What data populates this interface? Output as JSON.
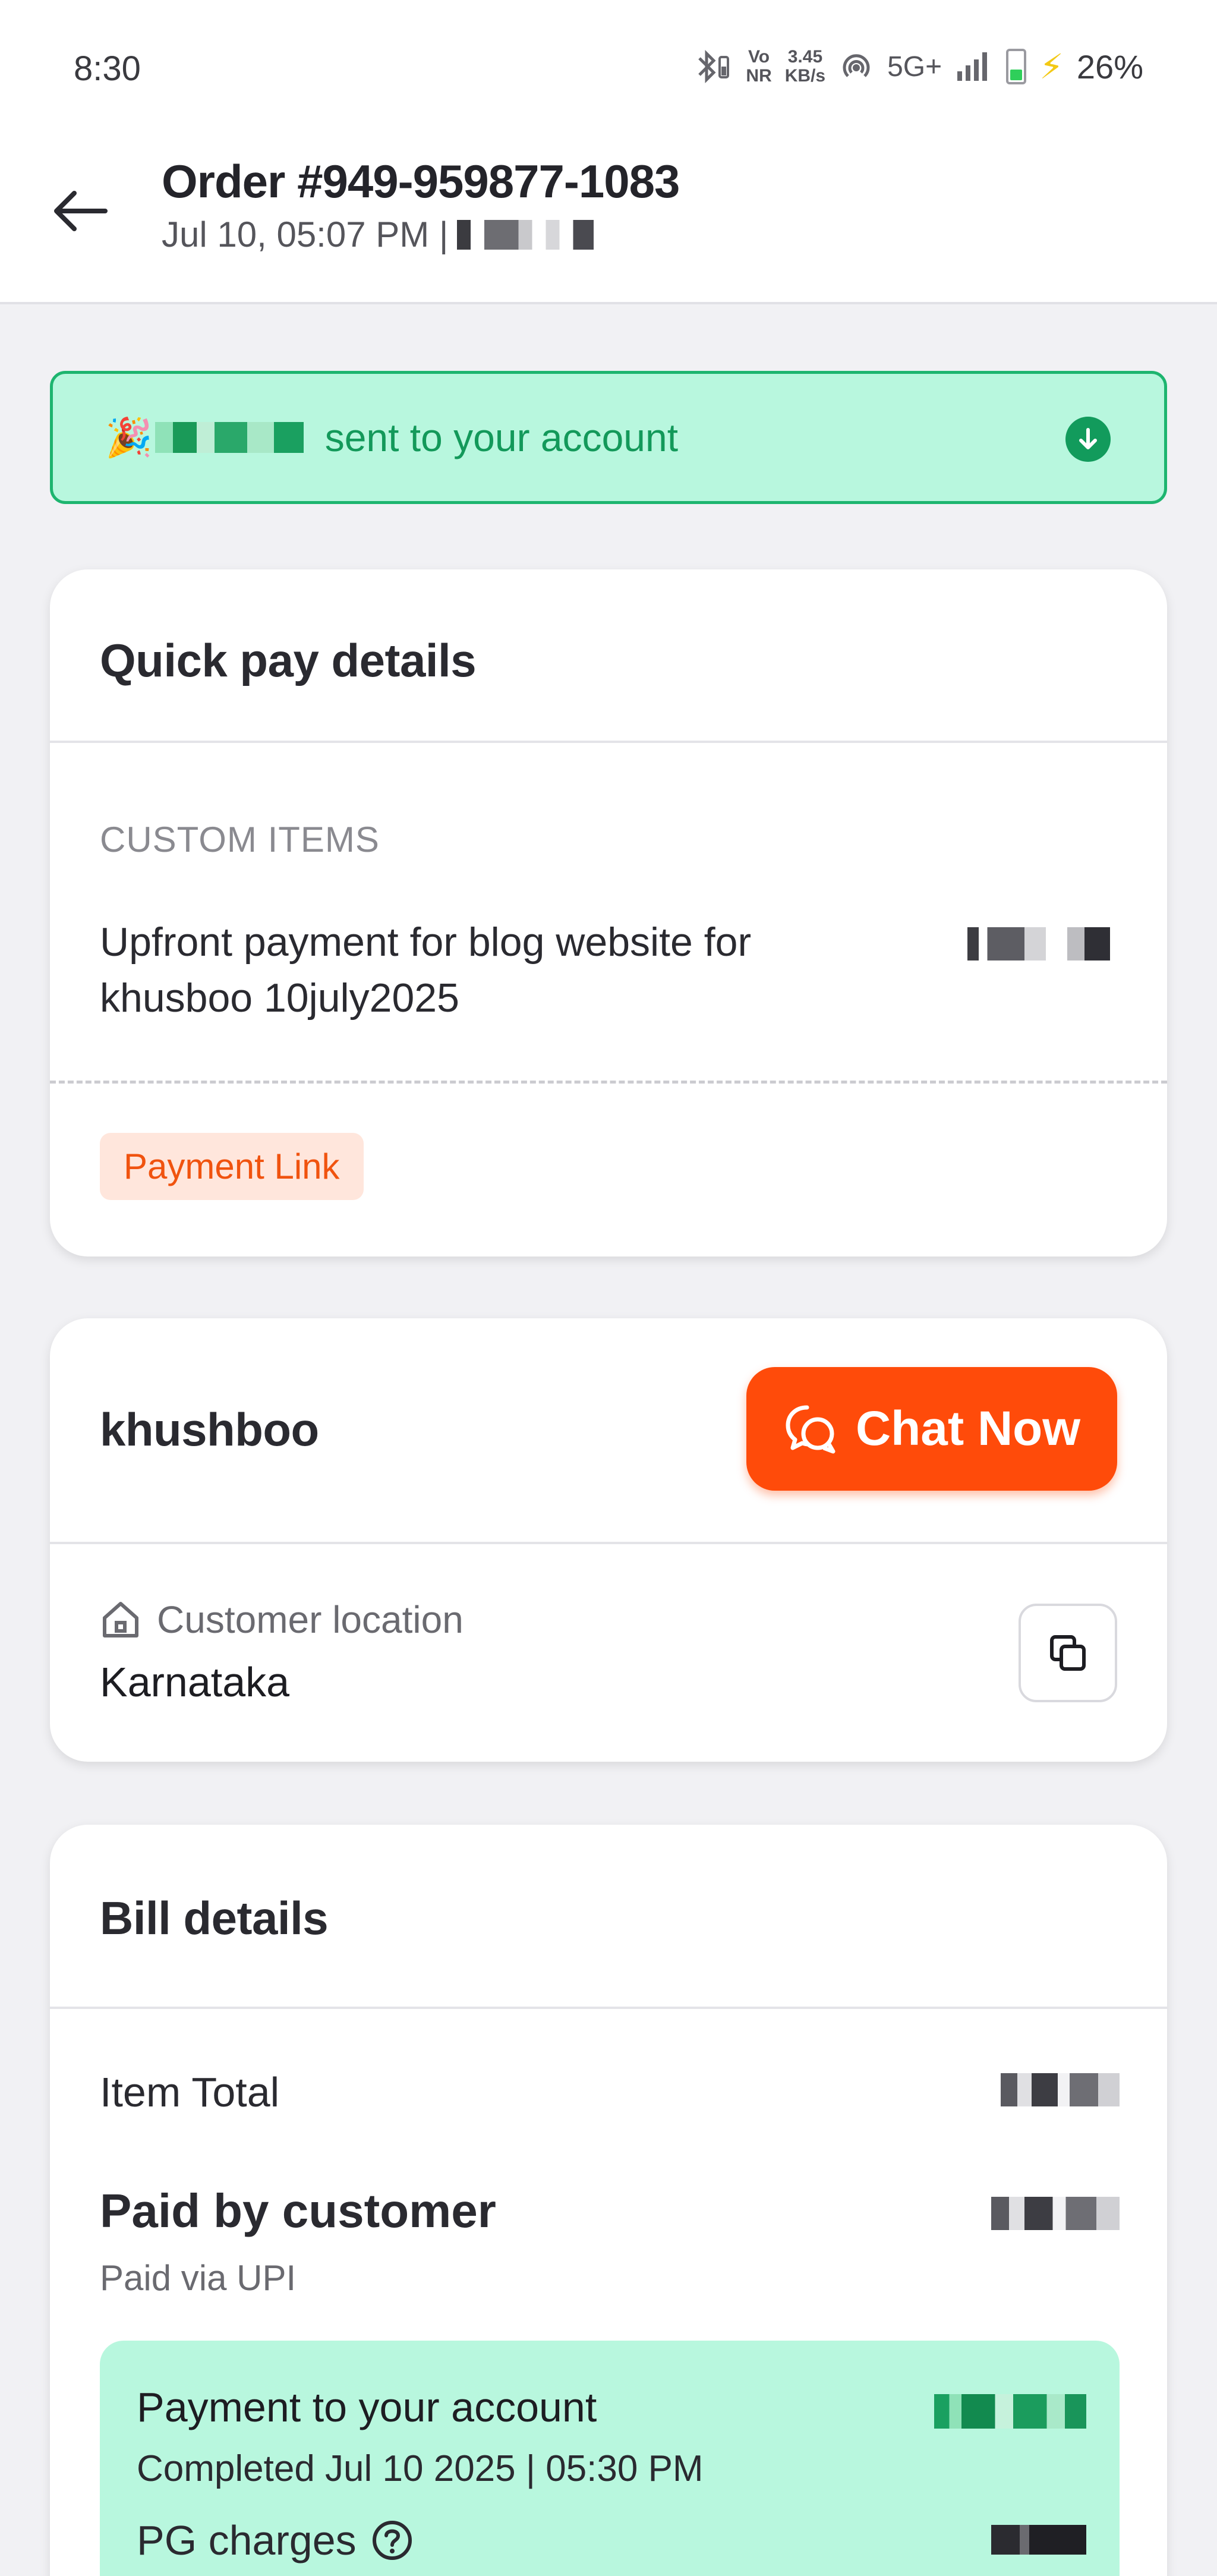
{
  "status_bar": {
    "time": "8:30",
    "bluetooth_icon": "bluetooth-icon",
    "volte_label": "Vo\nNR",
    "speed_value": "3.45",
    "speed_unit": "KB/s",
    "network": "5G+",
    "battery": "26%"
  },
  "header": {
    "title": "Order #949-959877-1083",
    "subtitle": "Jul 10, 05:07 PM |",
    "back_icon": "arrow-left-icon"
  },
  "banner": {
    "text": "sent to your account",
    "icon": "party-popper-icon",
    "color": "#13995a"
  },
  "quick_pay": {
    "title": "Quick pay details",
    "section_label": "CUSTOM ITEMS",
    "item_description": "Upfront payment for blog website for khusboo 10july2025",
    "badge": "Payment Link"
  },
  "customer": {
    "name": "khushboo",
    "chat_button": "Chat Now",
    "location_label": "Customer location",
    "location_value": "Karnataka"
  },
  "bill": {
    "title": "Bill details",
    "item_total_label": "Item Total",
    "paid_by_label": "Paid by customer",
    "paid_via": "Paid via UPI",
    "payment_title": "Payment to your account",
    "payment_status": "Completed Jul 10 2025 | 05:30 PM",
    "pg_charges_label": "PG charges"
  },
  "colors": {
    "accent": "#ff4b0a",
    "success_bg": "#b8f7de",
    "success_text": "#13995a"
  }
}
